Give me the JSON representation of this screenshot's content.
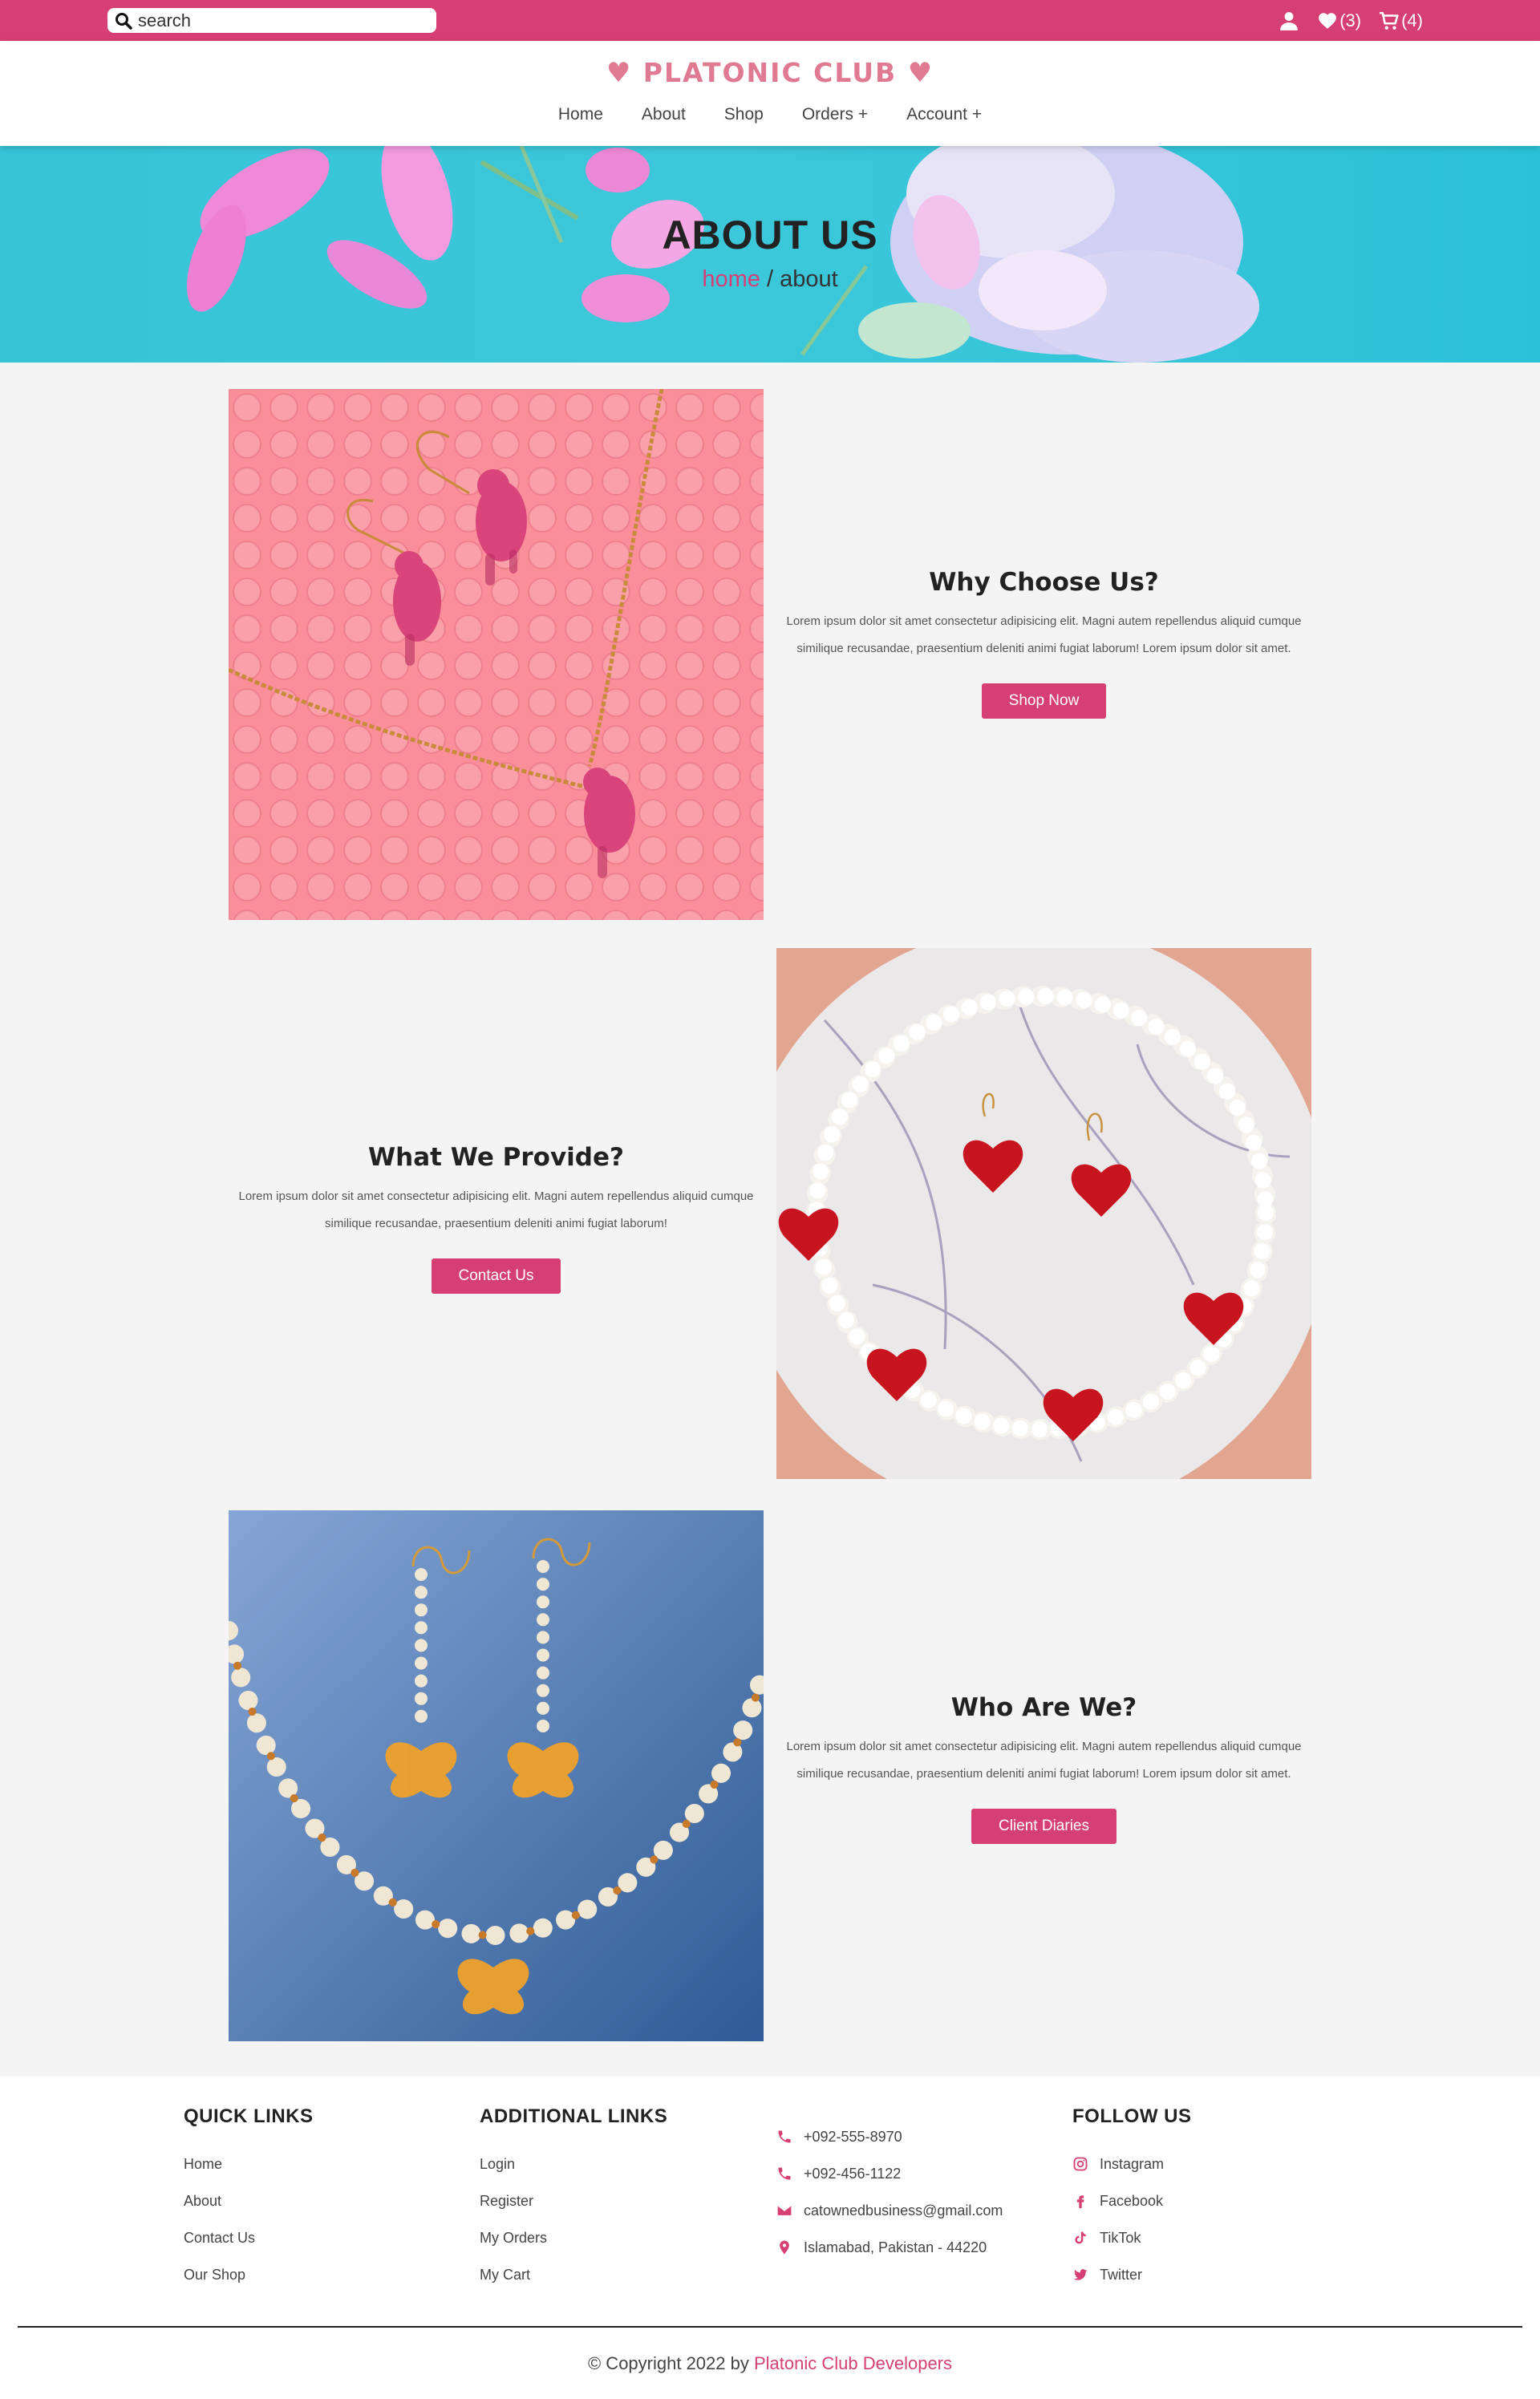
{
  "topbar": {
    "search_placeholder": "search",
    "wishlist_count": "(3)",
    "cart_count": "(4)"
  },
  "header": {
    "logo_text": "PLATONIC CLUB",
    "nav": [
      "Home",
      "About",
      "Shop",
      "Orders +",
      "Account +"
    ]
  },
  "hero": {
    "title": "ABOUT US",
    "crumb_home": "home",
    "crumb_sep": " / ",
    "crumb_current": "about"
  },
  "sections": [
    {
      "title": "Why Choose Us?",
      "text": "Lorem ipsum dolor sit amet consectetur adipisicing elit. Magni autem repellendus aliquid cumque similique recusandae, praesentium deleniti animi fugiat laborum! Lorem ipsum dolor sit amet.",
      "button": "Shop Now"
    },
    {
      "title": "What We Provide?",
      "text": "Lorem ipsum dolor sit amet consectetur adipisicing elit. Magni autem repellendus aliquid cumque similique recusandae, praesentium deleniti animi fugiat laborum!",
      "button": "Contact Us"
    },
    {
      "title": "Who Are We?",
      "text": "Lorem ipsum dolor sit amet consectetur adipisicing elit. Magni autem repellendus aliquid cumque similique recusandae, praesentium deleniti animi fugiat laborum! Lorem ipsum dolor sit amet.",
      "button": "Client Diaries"
    }
  ],
  "footer": {
    "quick_links": {
      "title": "QUICK LINKS",
      "items": [
        "Home",
        "About",
        "Contact Us",
        "Our Shop"
      ]
    },
    "additional_links": {
      "title": "ADDITIONAL LINKS",
      "items": [
        "Login",
        "Register",
        "My Orders",
        "My Cart"
      ]
    },
    "contact": [
      "+092-555-8970",
      "+092-456-1122",
      "catownedbusiness@gmail.com",
      "Islamabad, Pakistan - 44220"
    ],
    "follow": {
      "title": "FOLLOW US",
      "items": [
        "Instagram",
        "Facebook",
        "TikTok",
        "Twitter"
      ]
    },
    "copyright_prefix": "© Copyright 2022 by ",
    "copyright_dev": "Platonic Club Developers"
  },
  "colors": {
    "accent": "#d63f73",
    "logo": "#e07a92",
    "hero_bg": "#35c4d6"
  }
}
